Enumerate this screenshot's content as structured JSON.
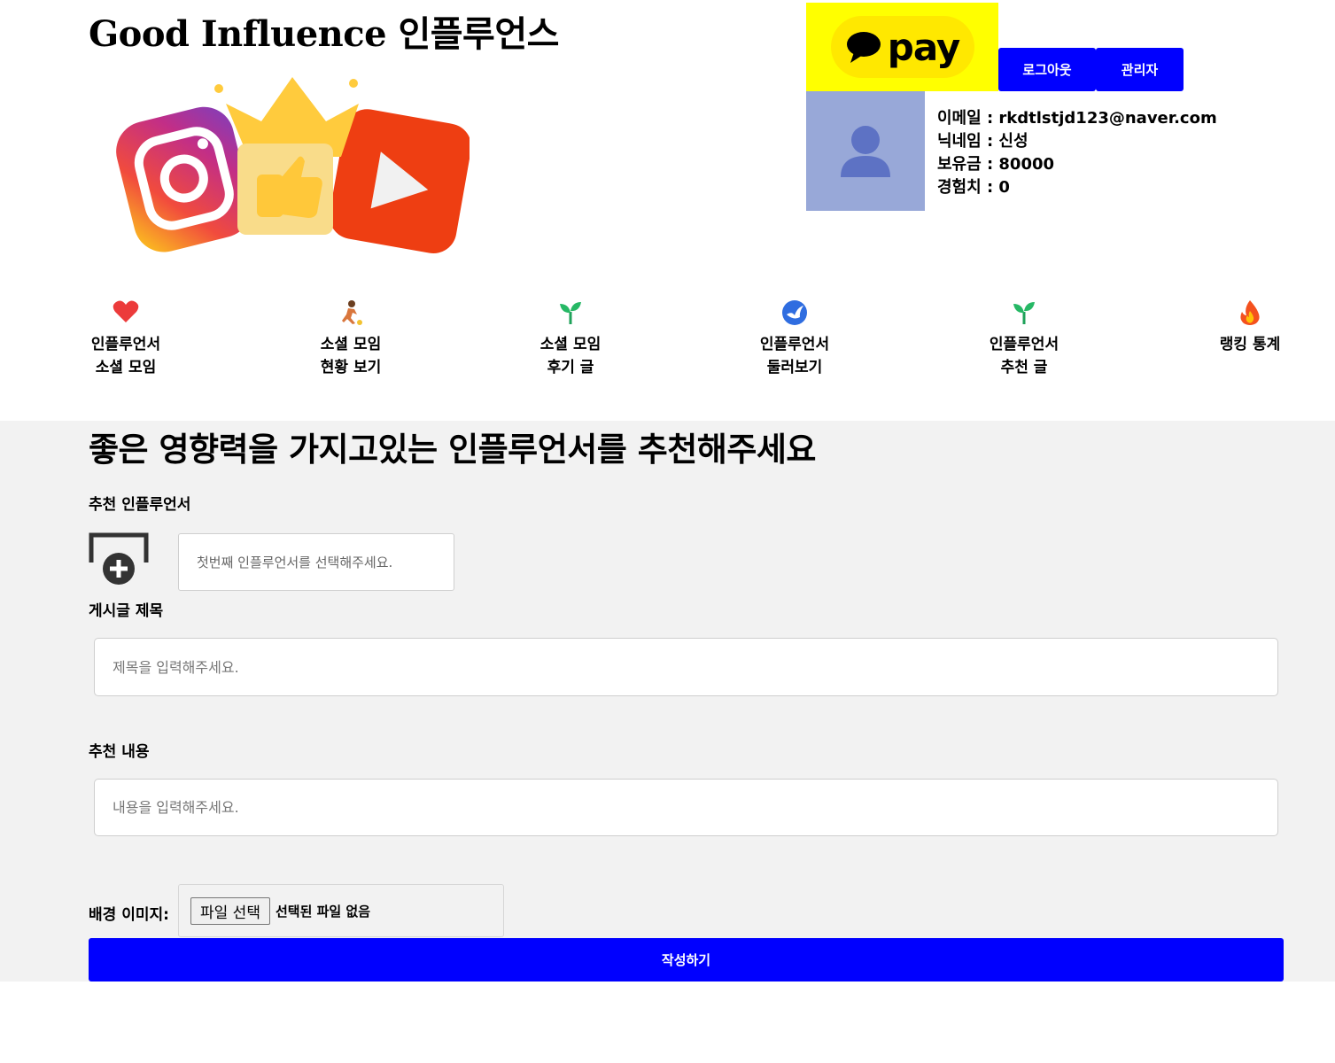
{
  "header": {
    "site_title": "Good Influence 인플루언스",
    "kakaopay_label": "pay",
    "logout_label": "로그아웃",
    "admin_label": "관리자"
  },
  "user": {
    "email": "이메일 : rkdtlstjd123@naver.com",
    "nickname": "닉네임 : 신성",
    "balance": "보유금 : 80000",
    "experience": "경험치 : 0"
  },
  "nav": {
    "items": [
      {
        "icon": "heart-icon",
        "line1": "인플루언서",
        "line2": "소셜 모임"
      },
      {
        "icon": "runner-icon",
        "line1": "소셜 모임",
        "line2": "현황 보기"
      },
      {
        "icon": "sprout-icon",
        "line1": "소셜 모임",
        "line2": "후기 글"
      },
      {
        "icon": "bird-icon",
        "line1": "인플루언서",
        "line2": "둘러보기"
      },
      {
        "icon": "sprout-icon",
        "line1": "인플루언서",
        "line2": "추천 글"
      },
      {
        "icon": "fire-icon",
        "line1": "랭킹 통계",
        "line2": ""
      }
    ]
  },
  "form": {
    "heading": "좋은 영향력을 가지고있는 인플루언서를 추천해주세요",
    "influencer_label": "추천 인플루언서",
    "influencer_placeholder": "첫번째 인플루언서를 선택해주세요.",
    "title_label": "게시글 제목",
    "title_placeholder": "제목을 입력해주세요.",
    "content_label": "추천 내용",
    "content_placeholder": "내용을 입력해주세요.",
    "image_label": "배경 이미지:",
    "file_button_label": "파일 선택",
    "file_status": "선택된 파일 없음",
    "submit_label": "작성하기"
  },
  "colors": {
    "primary_button": "#0000ff",
    "kakaopay_yellow": "#ffff00",
    "avatar_bg": "#98a8d8",
    "form_bg": "#f2f2f2"
  }
}
